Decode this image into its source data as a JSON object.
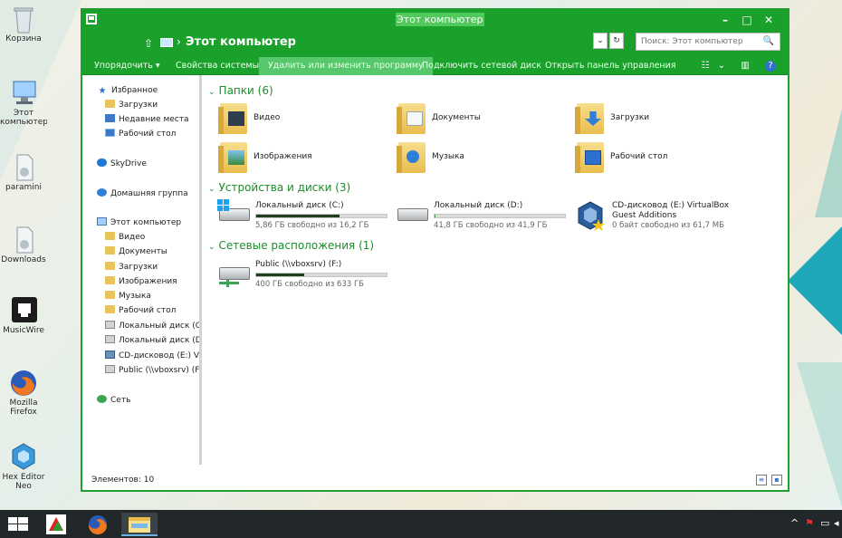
{
  "desktop": {
    "icons": [
      {
        "label": "Корзина",
        "icon": "recycle-bin-icon"
      },
      {
        "label": "Этот компьютер",
        "icon": "computer-icon"
      },
      {
        "label": "paramini",
        "icon": "file-icon"
      },
      {
        "label": "Downloads",
        "icon": "file-icon"
      },
      {
        "label": "MusicWire",
        "icon": "app-icon"
      },
      {
        "label": "Mozilla Firefox",
        "icon": "firefox-icon"
      },
      {
        "label": "Hex Editor Neo",
        "icon": "hex-editor-icon"
      }
    ]
  },
  "window": {
    "title": "Этот компьютер",
    "controls": {
      "minimize": "–",
      "maximize": "□",
      "close": "✕"
    },
    "address": {
      "up_icon": "⇧",
      "separator": "›",
      "location": "Этот компьютер",
      "dropdown_glyph": "⌄",
      "refresh_glyph": "↻"
    },
    "search": {
      "placeholder": "Поиск: Этот компьютер",
      "icon": "🔍"
    },
    "ribbon": {
      "items": [
        {
          "label": "Упорядочить ▾"
        },
        {
          "label": "Свойства системы"
        },
        {
          "label": "Удалить или изменить программу"
        },
        {
          "label": "Подключить сетевой диск"
        },
        {
          "label": "Открыть панель управления"
        }
      ],
      "view_glyph": "☷",
      "view_dropdown": "⌄",
      "pane_glyph": "▥",
      "help_glyph": "?"
    },
    "nav": {
      "favorites": "Избранное",
      "favorites_items": [
        "Загрузки",
        "Недавние места",
        "Рабочий стол"
      ],
      "skydrive": "SkyDrive",
      "homegroup": "Домашняя группа",
      "computer": "Этот компьютер",
      "computer_items": [
        "Видео",
        "Документы",
        "Загрузки",
        "Изображения",
        "Музыка",
        "Рабочий стол",
        "Локальный диск (C:)",
        "Локальный диск (D:)",
        "CD-дисковод (E:) VirtualBox",
        "Public (\\\\vboxsrv) (F:)"
      ],
      "network": "Сеть"
    },
    "groups": {
      "folders": "Папки (6)",
      "devices": "Устройства и диски (3)",
      "network": "Сетевые расположения (1)",
      "chevron": "⌄"
    },
    "folders": [
      "Видео",
      "Документы",
      "Загрузки",
      "Изображения",
      "Музыка",
      "Рабочий стол"
    ],
    "drives": [
      {
        "name": "Локальный диск (C:)",
        "free": "5,86 ГБ свободно из 16,2 ГБ",
        "used_fraction": 0.64,
        "bar_color": "#1f3f1f"
      },
      {
        "name": "Локальный диск (D:)",
        "free": "41,8 ГБ свободно из 41,9 ГБ",
        "used_fraction": 0.01,
        "bar_color": "#3aa655"
      },
      {
        "name": "CD-дисковод (E:) VirtualBox Guest Additions",
        "free": "0 байт свободно из 61,7 МБ"
      }
    ],
    "network_locations": [
      {
        "name": "Public (\\\\vboxsrv) (F:)",
        "free": "400 ГБ свободно из 633 ГБ",
        "used_fraction": 0.37,
        "bar_color": "#1f3f1f"
      }
    ],
    "status": {
      "count": "Элементов: 10"
    }
  },
  "colors": {
    "accent": "#1aa12b",
    "accent_light": "#56c76a"
  }
}
